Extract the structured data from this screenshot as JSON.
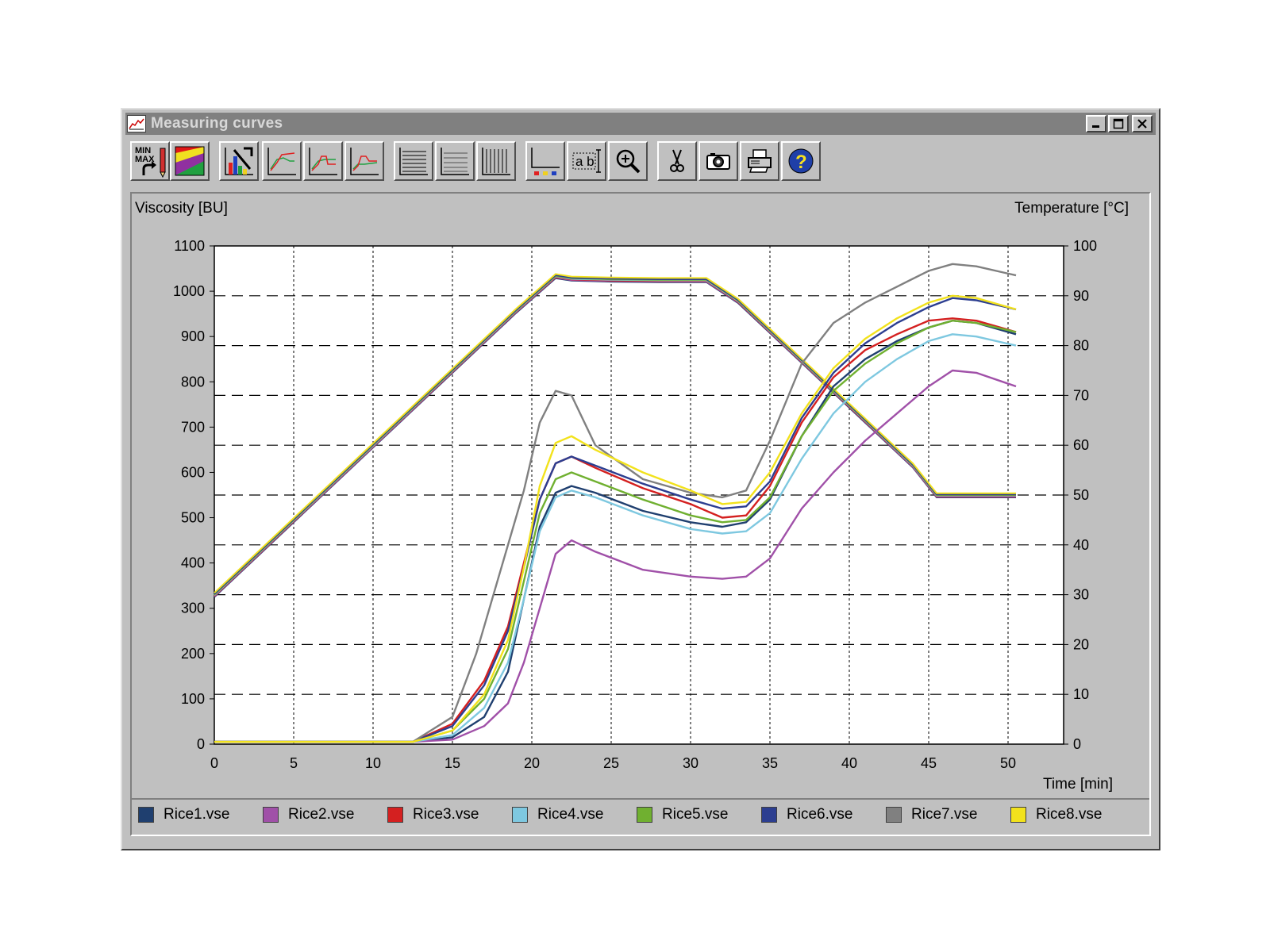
{
  "window": {
    "title": "Measuring curves",
    "controls": {
      "minimize": "minimize",
      "maximize": "maximize",
      "close": "close"
    }
  },
  "toolbar": {
    "buttons": [
      {
        "name": "minmax-button",
        "icon": "min-max-icon",
        "text": "MIN\nMAX"
      },
      {
        "name": "color-scheme-button",
        "icon": "color-palette-icon"
      },
      {
        "name": "chart-type-button",
        "icon": "bar-chart-icon"
      },
      {
        "name": "curve-view-1-button",
        "icon": "curve-icon"
      },
      {
        "name": "curve-view-2-button",
        "icon": "curve-icon"
      },
      {
        "name": "curve-view-3-button",
        "icon": "curve-icon"
      },
      {
        "name": "horizontal-grid-button",
        "icon": "horizontal-lines-icon"
      },
      {
        "name": "horizontal-grid-fine-button",
        "icon": "horizontal-lines-icon"
      },
      {
        "name": "vertical-grid-button",
        "icon": "vertical-lines-icon"
      },
      {
        "name": "axis-legend-button",
        "icon": "axis-legend-icon"
      },
      {
        "name": "text-label-button",
        "icon": "text-label-icon",
        "text": "ab"
      },
      {
        "name": "zoom-button",
        "icon": "zoom-in-icon"
      },
      {
        "name": "cut-button",
        "icon": "scissors-icon"
      },
      {
        "name": "snapshot-button",
        "icon": "camera-icon"
      },
      {
        "name": "print-button",
        "icon": "printer-icon"
      },
      {
        "name": "help-button",
        "icon": "help-icon"
      }
    ]
  },
  "chart_data": {
    "type": "line",
    "title": "",
    "ylabel": "Viscosity [BU]",
    "y2label": "Temperature [°C]",
    "xlabel": "Time [min]",
    "xlim": [
      0,
      53.5
    ],
    "ylim": [
      0,
      1100
    ],
    "y2lim": [
      0,
      100
    ],
    "x_ticks": [
      "0",
      "5",
      "10",
      "15",
      "20",
      "25",
      "30",
      "35",
      "40",
      "45",
      "50"
    ],
    "y_ticks": [
      "0",
      "100",
      "200",
      "300",
      "400",
      "500",
      "600",
      "700",
      "800",
      "900",
      "1000",
      "1100"
    ],
    "y2_ticks": [
      "0",
      "10",
      "20",
      "30",
      "40",
      "50",
      "60",
      "70",
      "80",
      "90",
      "100"
    ],
    "grid": true,
    "legend_position": "bottom",
    "temperature": {
      "x": [
        0,
        5,
        10,
        15,
        19,
        21.5,
        22.5,
        25,
        28,
        31,
        33,
        36,
        40,
        44,
        45.5,
        47,
        50.5
      ],
      "y": [
        30,
        45,
        60,
        75,
        87,
        94,
        93.5,
        93.3,
        93.2,
        93.2,
        89,
        80,
        68,
        56,
        50,
        50,
        50
      ]
    },
    "series": [
      {
        "name": "Rice1.vse",
        "color": "#1f3f6f",
        "x": [
          0,
          12.5,
          15,
          17,
          18.5,
          19.5,
          20.5,
          21.5,
          22.5,
          24,
          27,
          30,
          32,
          33.5,
          35,
          37,
          39,
          41,
          43,
          45,
          46.5,
          48,
          50.5
        ],
        "y": [
          5,
          5,
          15,
          60,
          160,
          320,
          480,
          555,
          570,
          555,
          515,
          490,
          480,
          490,
          540,
          680,
          790,
          850,
          890,
          920,
          935,
          930,
          905
        ]
      },
      {
        "name": "Rice2.vse",
        "color": "#a050a8",
        "x": [
          0,
          12.5,
          15,
          17,
          18.5,
          19.5,
          20.5,
          21.5,
          22.5,
          24,
          27,
          30,
          32,
          33.5,
          35,
          37,
          39,
          41,
          43,
          45,
          46.5,
          48,
          50.5
        ],
        "y": [
          5,
          5,
          10,
          40,
          90,
          180,
          300,
          420,
          450,
          425,
          385,
          370,
          365,
          370,
          410,
          520,
          600,
          670,
          730,
          790,
          825,
          820,
          790
        ]
      },
      {
        "name": "Rice3.vse",
        "color": "#d42020",
        "x": [
          0,
          12.5,
          15,
          17,
          18.5,
          19.5,
          20.5,
          21.5,
          22.5,
          24,
          27,
          30,
          32,
          33.5,
          35,
          37,
          39,
          41,
          43,
          45,
          46.5,
          48,
          50.5
        ],
        "y": [
          5,
          5,
          45,
          140,
          260,
          400,
          540,
          620,
          635,
          610,
          565,
          530,
          500,
          505,
          570,
          710,
          810,
          870,
          905,
          935,
          940,
          935,
          910
        ]
      },
      {
        "name": "Rice4.vse",
        "color": "#7ec8e0",
        "x": [
          0,
          12.5,
          15,
          17,
          18.5,
          19.5,
          20.5,
          21.5,
          22.5,
          24,
          27,
          30,
          32,
          33.5,
          35,
          37,
          39,
          41,
          43,
          45,
          46.5,
          48,
          50.5
        ],
        "y": [
          5,
          5,
          20,
          80,
          180,
          320,
          470,
          545,
          560,
          545,
          505,
          475,
          465,
          470,
          510,
          630,
          730,
          800,
          850,
          890,
          905,
          900,
          880
        ]
      },
      {
        "name": "Rice5.vse",
        "color": "#70b030",
        "x": [
          0,
          12.5,
          15,
          17,
          18.5,
          19.5,
          20.5,
          21.5,
          22.5,
          24,
          27,
          30,
          32,
          33.5,
          35,
          37,
          39,
          41,
          43,
          45,
          46.5,
          48,
          50.5
        ],
        "y": [
          5,
          5,
          30,
          100,
          210,
          360,
          510,
          585,
          600,
          580,
          540,
          505,
          490,
          495,
          545,
          680,
          780,
          840,
          885,
          920,
          935,
          930,
          910
        ]
      },
      {
        "name": "Rice6.vse",
        "color": "#2c3e90",
        "x": [
          0,
          12.5,
          15,
          17,
          18.5,
          19.5,
          20.5,
          21.5,
          22.5,
          24,
          27,
          30,
          32,
          33.5,
          35,
          37,
          39,
          41,
          43,
          45,
          46.5,
          48,
          50.5
        ],
        "y": [
          5,
          5,
          40,
          130,
          250,
          390,
          540,
          620,
          635,
          615,
          575,
          540,
          520,
          525,
          580,
          720,
          820,
          885,
          930,
          965,
          985,
          980,
          960
        ]
      },
      {
        "name": "Rice7.vse",
        "color": "#808080",
        "x": [
          0,
          12.5,
          15,
          16.5,
          18,
          19.5,
          20.5,
          21.5,
          22.5,
          24,
          27,
          30,
          32,
          33.5,
          35,
          37,
          39,
          41,
          43,
          45,
          46.5,
          48,
          50.5
        ],
        "y": [
          5,
          5,
          60,
          200,
          380,
          560,
          710,
          780,
          770,
          660,
          585,
          555,
          545,
          560,
          670,
          840,
          930,
          975,
          1010,
          1045,
          1060,
          1055,
          1035
        ]
      },
      {
        "name": "Rice8.vse",
        "color": "#f2e21c",
        "x": [
          0,
          12.5,
          15,
          17,
          18.5,
          19.5,
          20.5,
          21.5,
          22.5,
          24,
          27,
          30,
          32,
          33.5,
          35,
          37,
          39,
          41,
          43,
          45,
          46.5,
          48,
          50.5
        ],
        "y": [
          5,
          5,
          30,
          110,
          230,
          390,
          570,
          665,
          680,
          650,
          600,
          560,
          530,
          535,
          600,
          730,
          830,
          895,
          940,
          975,
          990,
          985,
          960
        ]
      }
    ]
  }
}
